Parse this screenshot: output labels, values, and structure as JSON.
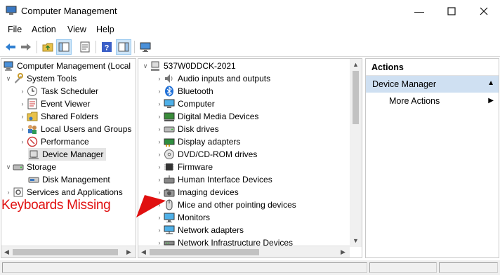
{
  "window": {
    "title": "Computer Management"
  },
  "menu": [
    "File",
    "Action",
    "View",
    "Help"
  ],
  "left_tree": [
    {
      "label": "Computer Management (Local",
      "icon": "computer-management-icon"
    },
    {
      "label": "System Tools",
      "icon": "system-tools-icon"
    },
    {
      "label": "Task Scheduler",
      "icon": "task-scheduler-icon"
    },
    {
      "label": "Event Viewer",
      "icon": "event-viewer-icon"
    },
    {
      "label": "Shared Folders",
      "icon": "shared-folders-icon"
    },
    {
      "label": "Local Users and Groups",
      "icon": "local-users-icon"
    },
    {
      "label": "Performance",
      "icon": "performance-icon"
    },
    {
      "label": "Device Manager",
      "icon": "device-manager-icon",
      "selected": true
    },
    {
      "label": "Storage",
      "icon": "storage-icon"
    },
    {
      "label": "Disk Management",
      "icon": "disk-management-icon"
    },
    {
      "label": "Services and Applications",
      "icon": "services-icon"
    }
  ],
  "device_tree": {
    "root": "537W0DDCK-2021",
    "categories": [
      {
        "label": "Audio inputs and outputs",
        "icon": "audio-icon"
      },
      {
        "label": "Bluetooth",
        "icon": "bluetooth-icon"
      },
      {
        "label": "Computer",
        "icon": "computer-icon"
      },
      {
        "label": "Digital Media Devices",
        "icon": "digital-media-icon"
      },
      {
        "label": "Disk drives",
        "icon": "disk-drive-icon"
      },
      {
        "label": "Display adapters",
        "icon": "display-adapter-icon"
      },
      {
        "label": "DVD/CD-ROM drives",
        "icon": "dvd-icon"
      },
      {
        "label": "Firmware",
        "icon": "firmware-icon"
      },
      {
        "label": "Human Interface Devices",
        "icon": "hid-icon"
      },
      {
        "label": "Imaging devices",
        "icon": "camera-icon"
      },
      {
        "label": "Mice and other pointing devices",
        "icon": "mouse-icon"
      },
      {
        "label": "Monitors",
        "icon": "monitor-icon"
      },
      {
        "label": "Network adapters",
        "icon": "network-adapter-icon"
      },
      {
        "label": "Network Infrastructure Devices",
        "icon": "network-infrastructure-icon"
      }
    ]
  },
  "actions": {
    "header": "Actions",
    "section": "Device Manager",
    "items": [
      "More Actions"
    ]
  },
  "annotation": {
    "text": "Keyboards Missing",
    "color": "#e01010"
  }
}
